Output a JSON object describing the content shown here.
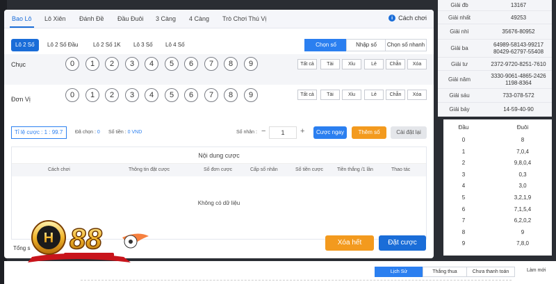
{
  "tabs": [
    "Bao Lô",
    "Lô Xiên",
    "Đánh Đề",
    "Đầu Đuôi",
    "3 Càng",
    "4 Càng",
    "Trò Chơi Thú Vị"
  ],
  "how_to_play": "Cách chơi",
  "subtabs": [
    "Lô 2 Số",
    "Lô 2 Số Đầu",
    "Lô 2 Số 1K",
    "Lô 3 Số",
    "Lô 4 Số"
  ],
  "modes": [
    "Chọn số",
    "Nhập số",
    "Chọn số nhanh"
  ],
  "rows": [
    {
      "label": "Chục",
      "balls": [
        "0",
        "1",
        "2",
        "3",
        "4",
        "5",
        "6",
        "7",
        "8",
        "9"
      ]
    },
    {
      "label": "Đơn Vị",
      "balls": [
        "0",
        "1",
        "2",
        "3",
        "4",
        "5",
        "6",
        "7",
        "8",
        "9"
      ]
    }
  ],
  "quick": [
    "Tất cả",
    "Tài",
    "Xỉu",
    "Lẻ",
    "Chẵn",
    "Xóa"
  ],
  "bet": {
    "ratio": "Tỉ lệ cược : 1 : 99.7",
    "chosen_label": "Đã chọn :",
    "chosen_value": "0",
    "money_label": "Số tiền :",
    "money_value": "0 VND",
    "multiplier_label": "Số nhân :",
    "minus": "−",
    "plus": "+",
    "multiplier_value": "1",
    "bet_now": "Cược ngay",
    "add_number": "Thêm số",
    "reset": "Cài đặt lại"
  },
  "panel": {
    "title": "Nội dung cược",
    "columns": [
      "Cách chơi",
      "Thông tin đặt cược",
      "Số đơn cược",
      "Cấp số nhân",
      "Số tiền cược",
      "Tiền thắng /1 lần",
      "Thao tác"
    ],
    "empty": "Không có dữ liệu"
  },
  "total_label": "Tổng s",
  "delete_all": "Xóa hết",
  "place_bet": "Đặt cược",
  "results": [
    {
      "name": "Giải đb",
      "value": "13167"
    },
    {
      "name": "Giải nhất",
      "value": "49253"
    },
    {
      "name": "Giải nhì",
      "value": "35676-80952"
    },
    {
      "name": "Giải ba",
      "value": "64989-58143-99217 80429-62797-55408"
    },
    {
      "name": "Giải tư",
      "value": "2372-9720-8251-7610"
    },
    {
      "name": "Giải năm",
      "value": "3330-9061-4865-2426 1198-8364"
    },
    {
      "name": "Giải sáu",
      "value": "733-078-572"
    },
    {
      "name": "Giải bảy",
      "value": "14-59-40-90"
    }
  ],
  "head_tail": {
    "headers": [
      "Đầu",
      "Đuôi"
    ],
    "rows": [
      [
        "0",
        "8"
      ],
      [
        "1",
        "7,0,4"
      ],
      [
        "2",
        "9,8,0,4"
      ],
      [
        "3",
        "0,3"
      ],
      [
        "4",
        "3,0"
      ],
      [
        "5",
        "3,2,1,9"
      ],
      [
        "6",
        "7,1,5,4"
      ],
      [
        "7",
        "6,2,0,2"
      ],
      [
        "8",
        "9"
      ],
      [
        "9",
        "7,8,0"
      ]
    ]
  },
  "bottom_tabs": [
    "Lịch Sử",
    "Thắng thua",
    "Chưa thanh toán"
  ],
  "refresh": "Làm mới",
  "colors": {
    "accent": "#1a6dd8",
    "orange": "#f39a1e",
    "red_digits": "#e0522c"
  }
}
